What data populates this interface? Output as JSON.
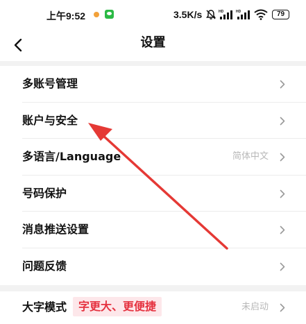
{
  "status_bar": {
    "time": "上午9:52",
    "net_speed": "3.5K/s",
    "signal_tag": "HD",
    "battery": "79"
  },
  "header": {
    "title": "设置"
  },
  "settings": {
    "items": [
      {
        "label": "多账号管理",
        "value": ""
      },
      {
        "label": "账户与安全",
        "value": ""
      },
      {
        "label": "多语言/Language",
        "value": "简体中文"
      },
      {
        "label": "号码保护",
        "value": ""
      },
      {
        "label": "消息推送设置",
        "value": ""
      },
      {
        "label": "问题反馈",
        "value": ""
      }
    ],
    "large_font": {
      "label": "大字模式",
      "tag": "字更大、更便捷",
      "value": "未启动"
    }
  },
  "colors": {
    "annotation_arrow": "#e53935",
    "tag_text": "#e5313f",
    "tag_bg": "#fde7ea"
  },
  "icons": {
    "back": "chevron-left-icon",
    "row": "chevron-right-icon"
  }
}
